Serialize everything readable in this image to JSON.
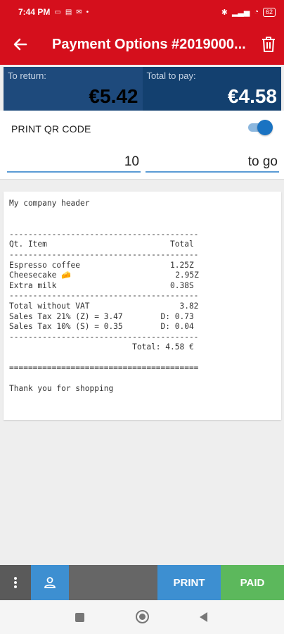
{
  "status_bar": {
    "time": "7:44 PM",
    "battery": "62",
    "icons": [
      "message-icon",
      "storage-icon",
      "mail-icon",
      "dot-icon",
      "bluetooth-icon",
      "signal-icon",
      "wifi-icon",
      "battery-icon"
    ]
  },
  "app_bar": {
    "title": "Payment Options #2019000...",
    "back_icon": "arrow-left-icon",
    "delete_icon": "trash-icon"
  },
  "amounts": {
    "return_label": "To return:",
    "return_value": "€5.42",
    "total_label": "Total to pay:",
    "total_value": "€4.58"
  },
  "qr": {
    "label": "PRINT QR CODE",
    "enabled": true
  },
  "inputs": {
    "amount_value": "10",
    "mode_value": "to go"
  },
  "receipt": {
    "lines": [
      "My company header",
      "",
      "",
      "----------------------------------------",
      "Qt. Item                          Total",
      "----------------------------------------",
      "Espresso coffee                   1.25Z",
      "Cheesecake 🧀                      2.95Z",
      "Extra milk                        0.38S",
      "----------------------------------------",
      "Total without VAT                   3.82",
      "Sales Tax 21% (Z) = 3.47        D: 0.73",
      "Sales Tax 10% (S) = 0.35        D: 0.04",
      "----------------------------------------",
      "                          Total: 4.58 €",
      "",
      "========================================",
      "",
      "Thank you for shopping"
    ]
  },
  "bottom_bar": {
    "menu_icon": "more-vertical-icon",
    "user_icon": "user-icon",
    "print_label": "PRINT",
    "paid_label": "PAID"
  },
  "colors": {
    "primary": "#d50f1c",
    "amount_box": "#1e4a7c",
    "print": "#3d8fd1",
    "paid": "#5cb85c"
  }
}
